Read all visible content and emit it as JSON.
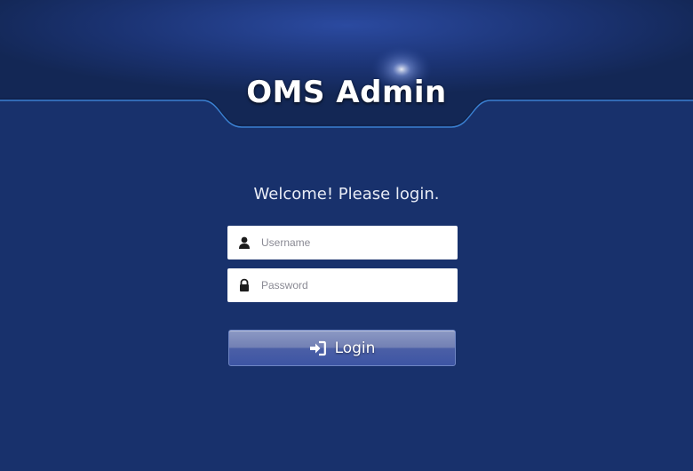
{
  "header": {
    "title": "OMS Admin"
  },
  "login": {
    "welcome_text": "Welcome! Please login.",
    "username_placeholder": "Username",
    "password_placeholder": "Password",
    "button_label": "Login"
  },
  "icons": {
    "username": "user-icon",
    "password": "lock-icon",
    "button": "sign-in-icon"
  },
  "colors": {
    "background": "#18316c",
    "header_dark": "#132755",
    "accent_line": "#3a7fd0",
    "button": "#4b5fa6"
  }
}
